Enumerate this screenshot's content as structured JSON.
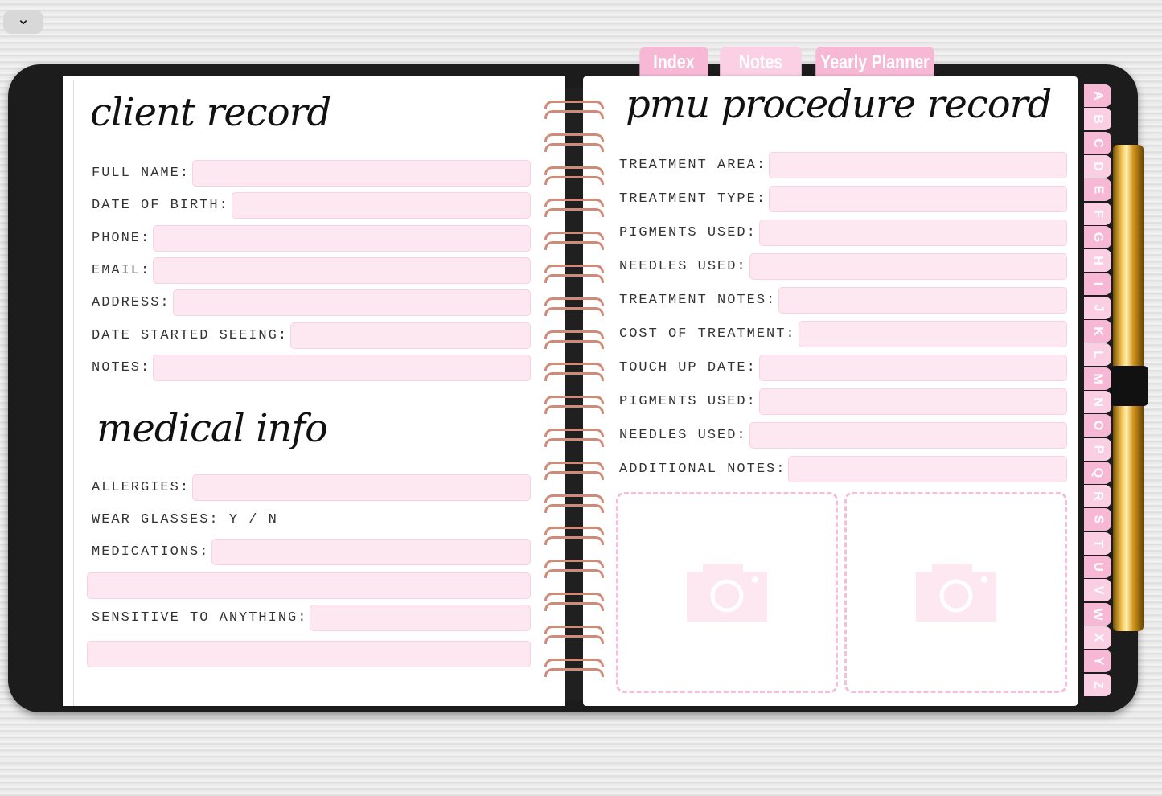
{
  "top_button": {
    "glyph": "⌄"
  },
  "top_tabs": [
    {
      "label": "Index"
    },
    {
      "label": "Notes"
    },
    {
      "label": "Yearly Planner"
    }
  ],
  "left_page": {
    "title": "client record",
    "fields": [
      "FULL NAME:",
      "DATE OF BIRTH:",
      "PHONE:",
      "EMAIL:",
      "ADDRESS:",
      "DATE STARTED SEEING:",
      "NOTES:"
    ],
    "medical_title": "medical info",
    "allergies": "ALLERGIES:",
    "glasses": "WEAR GLASSES: Y / N",
    "medications": "MEDICATIONS:",
    "sensitive": "SENSITIVE TO ANYTHING:"
  },
  "right_page": {
    "title": "pmu procedure record",
    "fields": [
      "TREATMENT AREA:",
      "TREATMENT TYPE:",
      "PIGMENTS USED:",
      "NEEDLES USED:",
      "TREATMENT NOTES:",
      "COST OF TREATMENT:",
      "TOUCH UP DATE:",
      "PIGMENTS USED:",
      "NEEDLES USED:",
      "ADDITIONAL NOTES:"
    ],
    "photo_icons": [
      "camera-icon",
      "camera-icon"
    ]
  },
  "alphabet_tabs": [
    "A",
    "B",
    "C",
    "D",
    "E",
    "F",
    "G",
    "H",
    "I",
    "J",
    "K",
    "L",
    "M",
    "N",
    "O",
    "P",
    "Q",
    "R",
    "S",
    "T",
    "U",
    "V",
    "W",
    "X",
    "Y",
    "Z"
  ],
  "colors": {
    "accent": "#f7b8d6",
    "field": "#fde7f1",
    "ring": "#d08a78"
  }
}
